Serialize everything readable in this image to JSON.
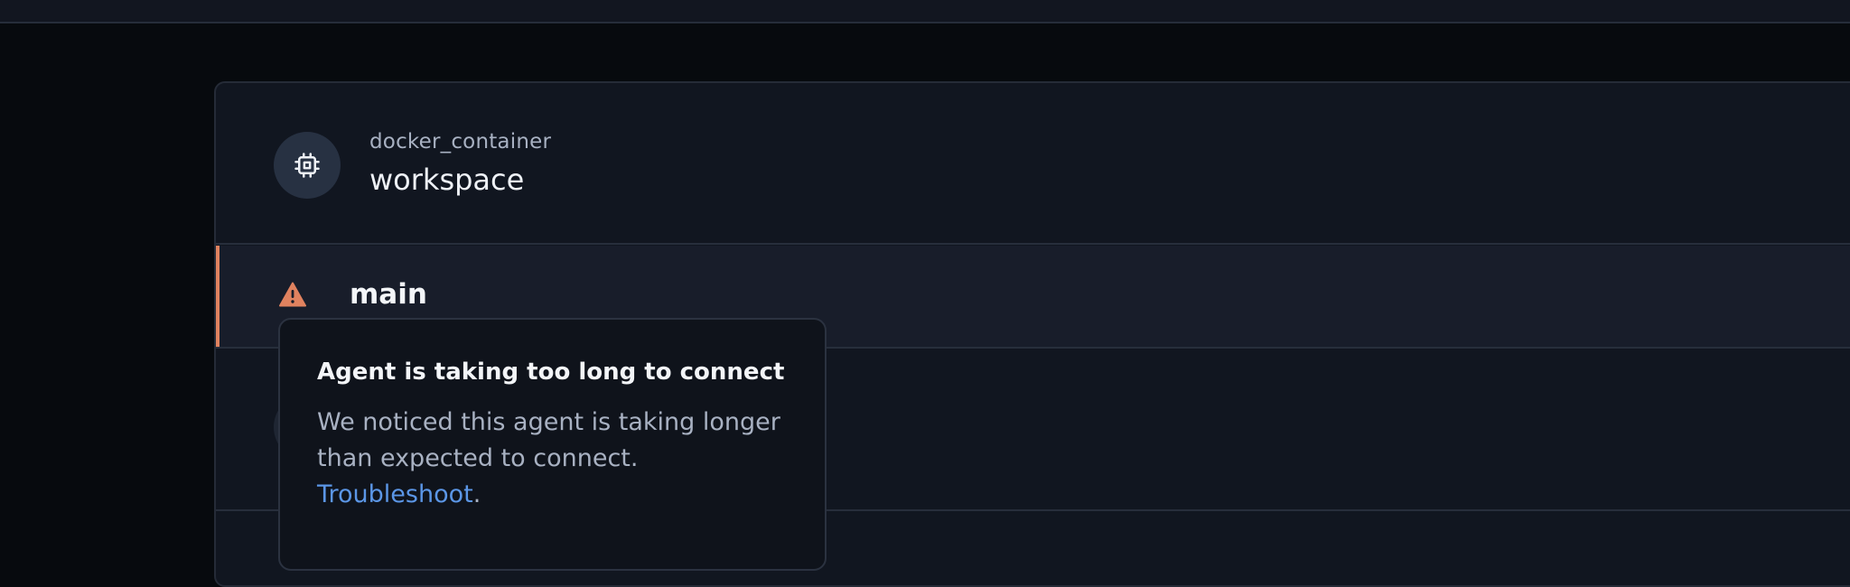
{
  "resource": {
    "type": "docker_container",
    "name": "workspace",
    "icon": "chip-icon"
  },
  "agent": {
    "name": "main",
    "status_icon": "warning-icon",
    "status_color": "#e0825f"
  },
  "tooltip": {
    "title": "Agent is taking too long to connect",
    "body": "We noticed this agent is taking longer than expected to connect.",
    "link_label": "Troubleshoot",
    "link_suffix": ".",
    "link_color": "#5b96e6"
  }
}
